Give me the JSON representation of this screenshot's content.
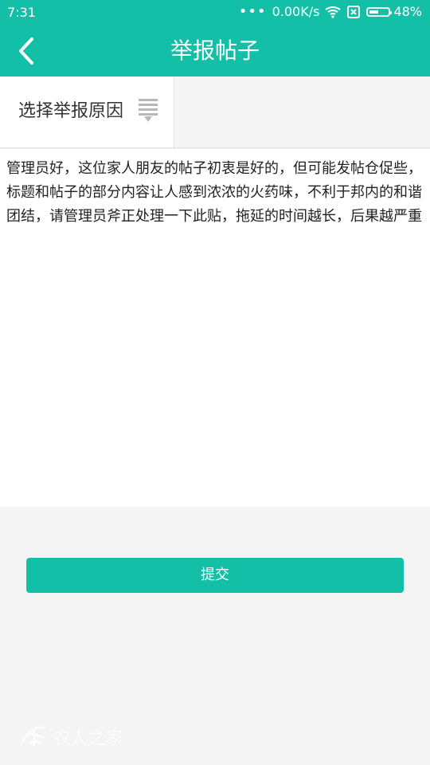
{
  "statusbar": {
    "time": "7:31",
    "network_speed": "0.00K/s",
    "battery_percent": "48%",
    "battery_level": 0.48,
    "icons": [
      "more-dots-icon",
      "wifi-icon",
      "sim-card-icon",
      "battery-icon"
    ]
  },
  "header": {
    "title": "举报帖子",
    "back_icon": "back-chevron-icon"
  },
  "reason": {
    "label": "选择举报原因",
    "icon": "filter-dropdown-icon"
  },
  "content": {
    "text": "管理员好，这位家人朋友的帖子初衷是好的，但可能发帖仓促些，标题和帖子的部分内容让人感到浓浓的火药味，不利于邦内的和谐团结，请管理员斧正处理一下此贴，拖延的时间越长，后果越严重"
  },
  "actions": {
    "submit_label": "提交"
  },
  "watermark": {
    "text": "农人之家",
    "icon": "watermark-logo"
  },
  "colors": {
    "accent": "#14bfa8",
    "background": "#f4f4f4",
    "text": "#222222"
  }
}
